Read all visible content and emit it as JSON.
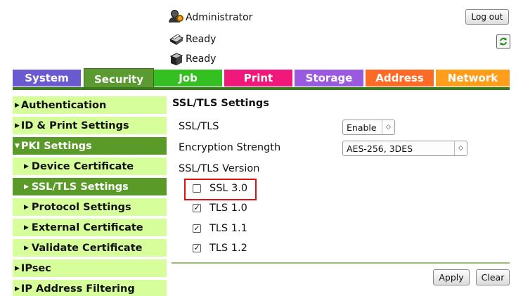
{
  "header": {
    "user": "Administrator",
    "logout_label": "Log out",
    "status_1": "Ready",
    "status_2": "Ready"
  },
  "tabs": [
    {
      "label": "System",
      "color": "#6a5ad0",
      "active": false
    },
    {
      "label": "Security",
      "color": "#5b9a30",
      "active": true
    },
    {
      "label": "Job",
      "color": "#33c020",
      "active": false
    },
    {
      "label": "Print",
      "color": "#f0187a",
      "active": false
    },
    {
      "label": "Storage",
      "color": "#9a5ae0",
      "active": false
    },
    {
      "label": "Address",
      "color": "#ff6a26",
      "active": false
    },
    {
      "label": "Network",
      "color": "#ff9e1a",
      "active": false
    }
  ],
  "sidebar": {
    "items": [
      {
        "label": "Authentication",
        "arrow": "▶"
      },
      {
        "label": "ID & Print Settings",
        "arrow": "▶"
      },
      {
        "label": "PKI Settings",
        "arrow": "▼"
      },
      {
        "label": "Device Certificate",
        "arrow": "▶"
      },
      {
        "label": "SSL/TLS Settings",
        "arrow": "▶"
      },
      {
        "label": "Protocol Settings",
        "arrow": "▶"
      },
      {
        "label": "External Certificate",
        "arrow": "▶"
      },
      {
        "label": "Validate Certificate",
        "arrow": "▶"
      },
      {
        "label": "IPsec",
        "arrow": "▶"
      },
      {
        "label": "IP Address Filtering",
        "arrow": "▶"
      }
    ]
  },
  "content": {
    "title": "SSL/TLS Settings",
    "ssltls_label": "SSL/TLS",
    "ssltls_value": "Enable",
    "strength_label": "Encryption Strength",
    "strength_value": "AES-256, 3DES",
    "version_label": "SSL/TLS Version",
    "versions": [
      {
        "label": "SSL 3.0",
        "checked": false
      },
      {
        "label": "TLS 1.0",
        "checked": true
      },
      {
        "label": "TLS 1.1",
        "checked": true
      },
      {
        "label": "TLS 1.2",
        "checked": true
      }
    ],
    "apply_label": "Apply",
    "clear_label": "Clear"
  }
}
